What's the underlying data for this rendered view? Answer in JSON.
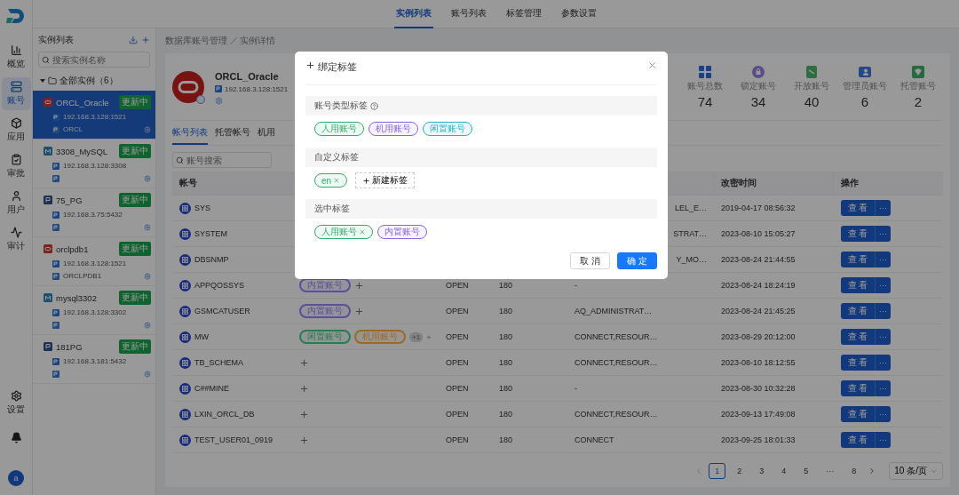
{
  "nav": [
    {
      "label": "概览",
      "kind": "chart",
      "selected": false
    },
    {
      "label": "账号",
      "kind": "account",
      "selected": true
    },
    {
      "label": "应用",
      "kind": "app",
      "selected": false
    },
    {
      "label": "审批",
      "kind": "approval",
      "selected": false
    },
    {
      "label": "用户",
      "kind": "user",
      "selected": false
    },
    {
      "label": "审计",
      "kind": "audit",
      "selected": false
    }
  ],
  "nav_bottom": {
    "settings": "设置",
    "avatar": "a"
  },
  "top_tabs": [
    {
      "label": "实例列表",
      "selected": true
    },
    {
      "label": "账号列表",
      "selected": false
    },
    {
      "label": "标签管理",
      "selected": false
    },
    {
      "label": "参数设置",
      "selected": false
    }
  ],
  "instance_panel": {
    "title": "实例列表",
    "search": {
      "placeholder": "搜索实例名称"
    },
    "tree": {
      "label": "全部实例（6）",
      "expanded": true,
      "children": [
        {
          "name": "ORCL_Oracle",
          "kind": "oracle",
          "badge": "更新中",
          "ip": "192.168.3.128:1521",
          "db": "ORCL",
          "selected": true
        },
        {
          "name": "3308_MySQL",
          "kind": "mysql",
          "badge": "更新中",
          "ip": "192.168.3.128:3308",
          "selected": false
        },
        {
          "name": "75_PG",
          "kind": "pg",
          "badge": "更新中",
          "ip": "192.168.3.75:5432",
          "selected": false
        },
        {
          "name": "orclpdb1",
          "kind": "oracle",
          "badge": "更新中",
          "ip": "192.168.3.128:1521",
          "db": "ORCLPDB1",
          "selected": false
        },
        {
          "name": "mysql3302",
          "kind": "mysql",
          "badge": "更新中",
          "ip": "192.168.3.128:3302",
          "selected": false
        },
        {
          "name": "181PG",
          "kind": "pg",
          "badge": "更新中",
          "ip": "192.168.3.181:5432",
          "selected": false
        }
      ]
    }
  },
  "breadcrumb": [
    "数据库账号管理",
    "实例详情"
  ],
  "instance": {
    "name": "ORCL_Oracle",
    "ip": "192.168.3.128:1521"
  },
  "stats": [
    {
      "label": "账号总数",
      "value": "74",
      "kind": "total"
    },
    {
      "label": "锁定账号",
      "value": "34",
      "kind": "locked"
    },
    {
      "label": "开放账号",
      "value": "40",
      "kind": "open"
    },
    {
      "label": "管理员账号",
      "value": "6",
      "kind": "admin"
    },
    {
      "label": "托管账号",
      "value": "2",
      "kind": "hosted"
    }
  ],
  "tabs": [
    {
      "label": "帐号列表",
      "selected": true
    },
    {
      "label": "托管帐号",
      "selected": false
    },
    {
      "label": "机用",
      "selected": false
    }
  ],
  "account_search": {
    "placeholder": "账号搜索"
  },
  "table": {
    "columns": [
      "帐号",
      "改密时间",
      "操作"
    ],
    "rows": [
      {
        "account": "SYS",
        "roles_partial": "LEL_E…",
        "changed": "2019-04-17 08:56:32",
        "view": "查 看",
        "more": "···"
      },
      {
        "account": "SYSTEM",
        "roles_partial": "STRAT…",
        "changed": "2023-08-10 15:05:27",
        "view": "查 看",
        "more": "···"
      },
      {
        "account": "DBSNMP",
        "roles_partial": "Y_MO…",
        "changed": "2023-08-24 21:44:55",
        "view": "查 看",
        "more": "···"
      },
      {
        "account": "APPQOSSYS",
        "tags": [
          {
            "label": "内置账号",
            "color": "#5d4e99"
          }
        ],
        "status": "OPEN",
        "limit": "180",
        "roles": "-",
        "changed": "2023-08-24 18:24:19",
        "view": "查 看",
        "more": "···"
      },
      {
        "account": "GSMCATUSER",
        "tags": [
          {
            "label": "内置账号",
            "color": "#5d4e99"
          }
        ],
        "status": "OPEN",
        "limit": "180",
        "roles": "AQ_ADMINISTRAT…",
        "changed": "2023-08-24 21:45:25",
        "view": "查 看",
        "more": "···"
      },
      {
        "account": "MW",
        "tags": [
          {
            "label": "闲置账号",
            "color": "#2a7b51"
          },
          {
            "label": "机用账号",
            "color": "#99692a"
          }
        ],
        "tags_extra": "+1",
        "status": "OPEN",
        "limit": "180",
        "roles": "CONNECT,RESOUR…",
        "changed": "2023-08-29 20:12:00",
        "view": "查 看",
        "more": "···"
      },
      {
        "account": "TB_SCHEMA",
        "tags": [],
        "status": "OPEN",
        "limit": "180",
        "roles": "CONNECT,RESOUR…",
        "changed": "2023-08-10 18:12:55",
        "view": "查 看",
        "more": "···"
      },
      {
        "account": "C##MINE",
        "tags": [],
        "status": "OPEN",
        "limit": "180",
        "roles": "-",
        "changed": "2023-08-30 10:32:28",
        "view": "查 看",
        "more": "···"
      },
      {
        "account": "LXIN_ORCL_DB",
        "tags": [],
        "status": "OPEN",
        "limit": "180",
        "roles": "CONNECT,RESOUR…",
        "changed": "2023-09-13 17:49:08",
        "view": "查 看",
        "more": "···"
      },
      {
        "account": "TEST_USER01_0919",
        "tags": [],
        "status": "OPEN",
        "limit": "180",
        "roles": "CONNECT",
        "changed": "2023-09-25 18:01:33",
        "view": "查 看",
        "more": "···"
      }
    ]
  },
  "pagination": {
    "pages": [
      {
        "label": "1",
        "selected": true
      },
      {
        "label": "2",
        "selected": false
      },
      {
        "label": "3",
        "selected": false
      },
      {
        "label": "4",
        "selected": false
      },
      {
        "label": "5",
        "selected": false
      },
      {
        "label": "···",
        "selected": false
      },
      {
        "label": "8",
        "selected": false
      }
    ],
    "page_size": "10 条/页"
  },
  "modal": {
    "title": "绑定标签",
    "sections": [
      {
        "title": "账号类型标签",
        "help": true,
        "tags": [
          {
            "label": "人用账号",
            "color": "#2fae6b",
            "closable": false
          },
          {
            "label": "机用账号",
            "color": "#8a63e0",
            "closable": false
          },
          {
            "label": "闲置账号",
            "color": "#22b3cc",
            "closable": false
          }
        ]
      },
      {
        "title": "自定义标签",
        "help": false,
        "tags": [
          {
            "label": "en",
            "color": "#2fae6b",
            "closable": true
          }
        ],
        "new_tag": "新建标签"
      },
      {
        "title": "选中标签",
        "help": false,
        "tags": [
          {
            "label": "人用账号",
            "color": "#2fae6b",
            "closable": true
          },
          {
            "label": "内置账号",
            "color": "#8a63e0",
            "closable": false
          }
        ]
      }
    ],
    "cancel": "取 消",
    "confirm": "确 定"
  }
}
